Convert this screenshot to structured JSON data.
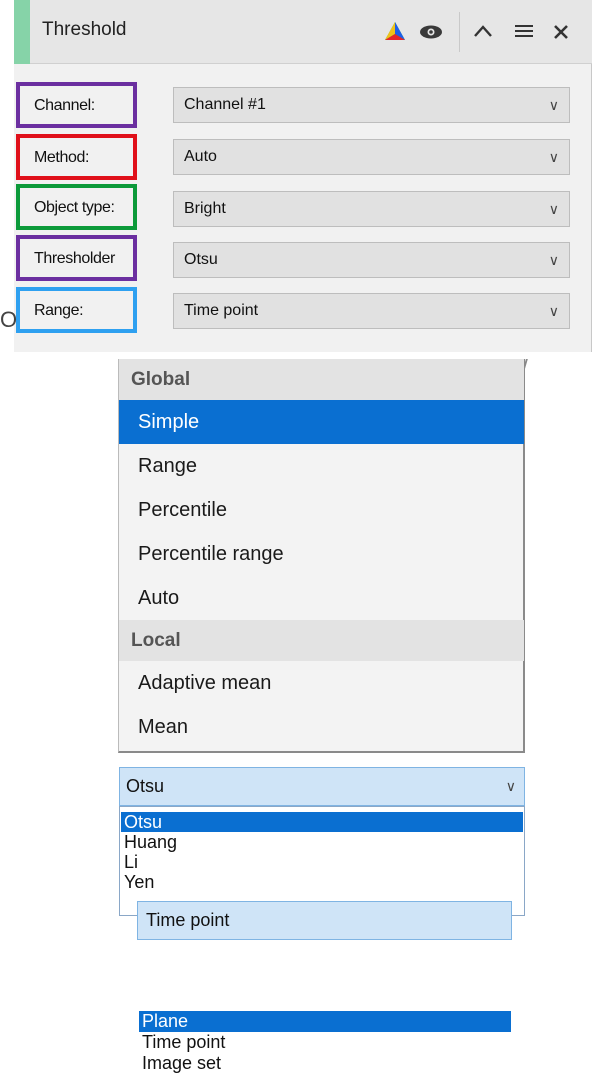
{
  "panel": {
    "title": "Threshold",
    "accent_color": "#86d3a8",
    "icons": [
      "color-wheel-icon",
      "eye-icon",
      "chevron-up-icon",
      "menu-icon",
      "close-icon"
    ],
    "fields": [
      {
        "label": "Channel:",
        "value": "Channel #1",
        "highlight": "#6b2fa0"
      },
      {
        "label": "Method:",
        "value": "Auto",
        "highlight": "#e0101a"
      },
      {
        "label": "Object type:",
        "value": "Bright",
        "highlight": "#0c9a3a"
      },
      {
        "label": "Thresholder",
        "value": "Otsu",
        "highlight": "#6b2fa0"
      },
      {
        "label": "Range:",
        "value": "Time point",
        "highlight": "#2ea0f0"
      }
    ]
  },
  "stray": {
    "left_char": "O",
    "right_char": "W"
  },
  "method_menu": {
    "groups": [
      {
        "name": "Global",
        "items": [
          "Simple",
          "Range",
          "Percentile",
          "Percentile range",
          "Auto"
        ]
      },
      {
        "name": "Local",
        "items": [
          "Adaptive mean",
          "Mean"
        ]
      }
    ],
    "selected": "Simple",
    "selected_color": "#0a6fd1"
  },
  "thresholder_combo": {
    "value": "Otsu",
    "options": [
      "Otsu",
      "Huang",
      "Li",
      "Yen"
    ],
    "selected": "Otsu"
  },
  "range_combo": {
    "value": "Time point",
    "options": [
      "Plane",
      "Time point",
      "Image set"
    ],
    "selected": "Plane"
  }
}
